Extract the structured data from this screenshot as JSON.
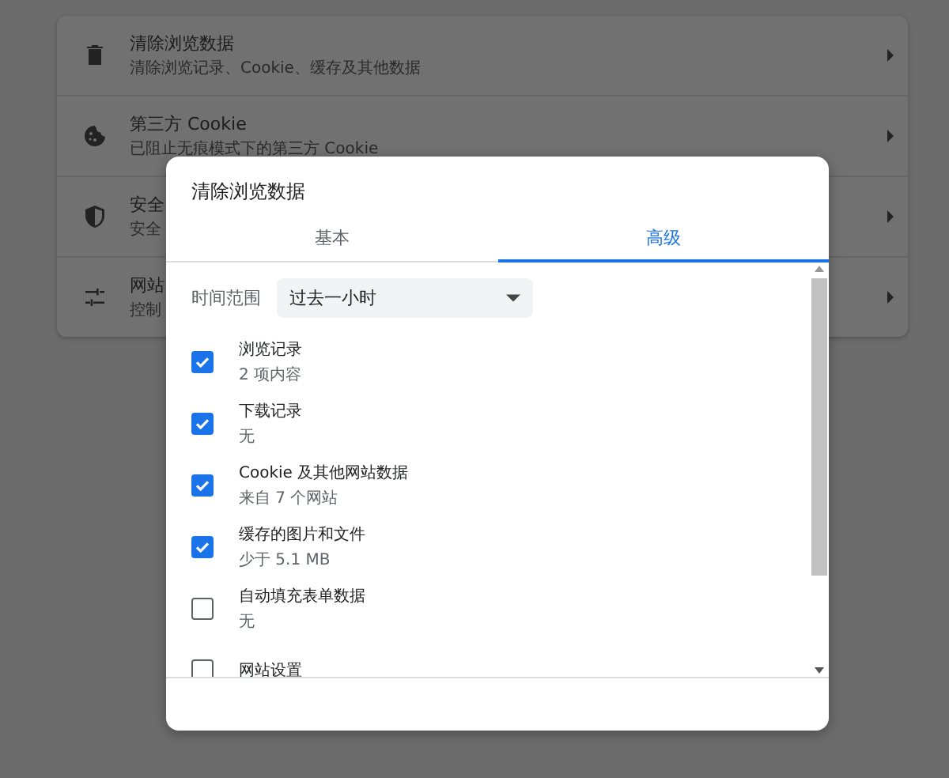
{
  "settings_list": [
    {
      "title": "清除浏览数据",
      "subtitle": "清除浏览记录、Cookie、缓存及其他数据"
    },
    {
      "title": "第三方 Cookie",
      "subtitle": "已阻止无痕模式下的第三方 Cookie"
    },
    {
      "title": "安全",
      "subtitle": "安全"
    },
    {
      "title": "网站",
      "subtitle": "控制"
    }
  ],
  "dialog": {
    "title": "清除浏览数据",
    "tabs": [
      {
        "label": "基本",
        "selected": false
      },
      {
        "label": "高级",
        "selected": true
      }
    ],
    "time_range": {
      "label": "时间范围",
      "value": "过去一小时"
    },
    "items": [
      {
        "label": "浏览记录",
        "detail": "2 项内容",
        "checked": true
      },
      {
        "label": "下载记录",
        "detail": "无",
        "checked": true
      },
      {
        "label": "Cookie 及其他网站数据",
        "detail": "来自 7 个网站",
        "checked": true
      },
      {
        "label": "缓存的图片和文件",
        "detail": "少于 5.1 MB",
        "checked": true
      },
      {
        "label": "自动填充表单数据",
        "detail": "无",
        "checked": false
      },
      {
        "label": "网站设置",
        "checked": false
      }
    ]
  }
}
